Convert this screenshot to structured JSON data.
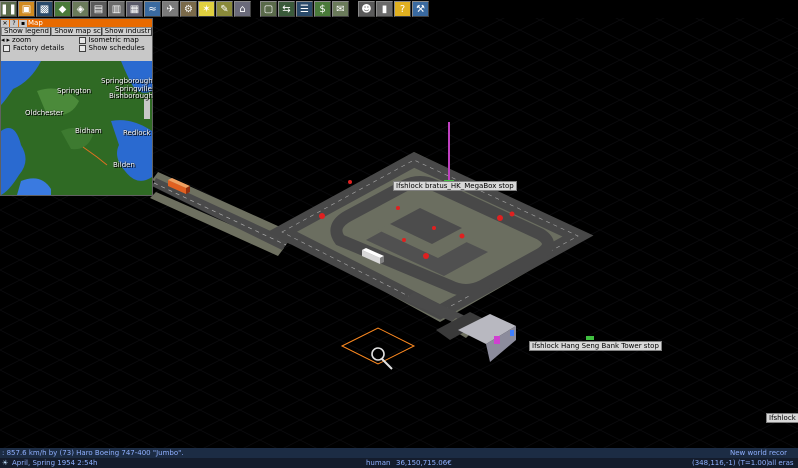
{
  "toolbar": {
    "buttons": [
      {
        "name": "pause-button",
        "glyph": "❚❚"
      },
      {
        "name": "main-menu-button",
        "glyph": "▣"
      },
      {
        "name": "minimap-button",
        "glyph": "▩"
      },
      {
        "name": "terraform-button",
        "glyph": "◆"
      },
      {
        "name": "landscape-button",
        "glyph": "◈"
      },
      {
        "name": "road-tools-button",
        "glyph": "▤"
      },
      {
        "name": "rail-tools-button",
        "glyph": "▥"
      },
      {
        "name": "tram-tools-button",
        "glyph": "▦"
      },
      {
        "name": "water-tools-button",
        "glyph": "≈"
      },
      {
        "name": "air-tools-button",
        "glyph": "✈"
      },
      {
        "name": "industry-tools-button",
        "glyph": "⚙"
      },
      {
        "name": "special-tools-button",
        "glyph": "✶"
      },
      {
        "name": "misc-tools-button",
        "glyph": "✎"
      },
      {
        "name": "city-tools-button",
        "glyph": "⌂"
      },
      {
        "name": "depot-button",
        "glyph": "▢"
      },
      {
        "name": "line-management-button",
        "glyph": "⇆"
      },
      {
        "name": "convoy-list-button",
        "glyph": "☰"
      },
      {
        "name": "finances-button",
        "glyph": "$"
      },
      {
        "name": "messages-button",
        "glyph": "✉"
      },
      {
        "name": "players-button",
        "glyph": "☻"
      },
      {
        "name": "goods-list-button",
        "glyph": "▮"
      },
      {
        "name": "help-button",
        "glyph": "?"
      },
      {
        "name": "settings-button",
        "glyph": "⚒"
      }
    ]
  },
  "map_window": {
    "title": "Map",
    "buttons": [
      "Show legend",
      "Show map scale",
      "Show industry"
    ],
    "options_left": [
      "zoom",
      "Factory details"
    ],
    "options_right": [
      "Isometric map",
      "Show schedules"
    ],
    "cities": [
      {
        "name": "Springton"
      },
      {
        "name": "Springborough"
      },
      {
        "name": "Springville"
      },
      {
        "name": "Bishborough"
      },
      {
        "name": "Oldchester"
      },
      {
        "name": "Bidham"
      },
      {
        "name": "Redlock"
      },
      {
        "name": "Bilden"
      }
    ]
  },
  "world": {
    "stops": [
      {
        "label": "Ifshlock bratus_HK_MegaBox stop"
      },
      {
        "label": "Ifshlock Hang Seng Bank Tower stop"
      },
      {
        "label": "Ifshlock s"
      }
    ]
  },
  "ticker": {
    "left": ": 857.6 km/h by (73) Haro Boeing 747-400 \"Jumbo\".",
    "right": "New world recor"
  },
  "status": {
    "date": "April, Spring 1954  2:54h",
    "player": "human",
    "money": "36,150,715.06€",
    "coords": "(348,116,-1) (T=1.00)",
    "eras": "all eras"
  },
  "colors": {
    "accent": "#e86a00",
    "ticker_bg": "#1c2c44",
    "status_text": "#8fb0ff"
  }
}
